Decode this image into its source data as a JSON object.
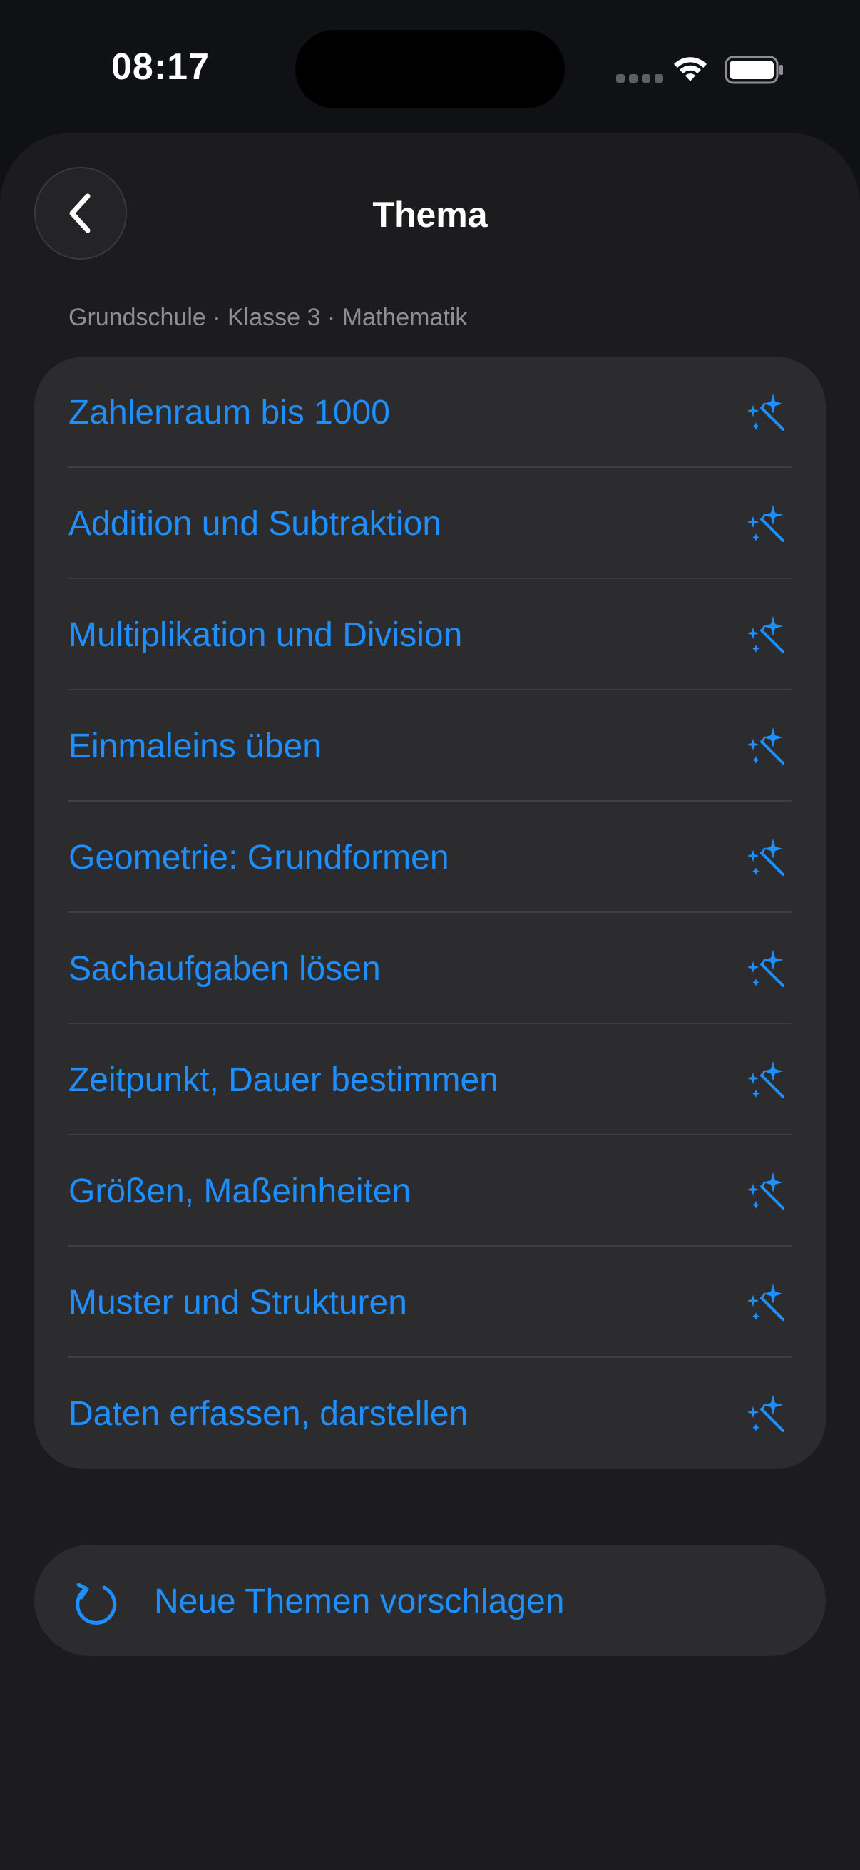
{
  "status_bar": {
    "time": "08:17"
  },
  "header": {
    "title": "Thema",
    "back_icon": "chevron-left-icon"
  },
  "breadcrumb": "Grundschule · Klasse 3 · Mathematik",
  "topics": [
    {
      "label": "Zahlenraum bis 1000",
      "icon": "magic-wand-icon"
    },
    {
      "label": "Addition und Subtraktion",
      "icon": "magic-wand-icon"
    },
    {
      "label": "Multiplikation und Division",
      "icon": "magic-wand-icon"
    },
    {
      "label": "Einmaleins üben",
      "icon": "magic-wand-icon"
    },
    {
      "label": "Geometrie: Grundformen",
      "icon": "magic-wand-icon"
    },
    {
      "label": "Sachaufgaben lösen",
      "icon": "magic-wand-icon"
    },
    {
      "label": "Zeitpunkt, Dauer bestimmen",
      "icon": "magic-wand-icon"
    },
    {
      "label": "Größen, Maßeinheiten",
      "icon": "magic-wand-icon"
    },
    {
      "label": "Muster und Strukturen",
      "icon": "magic-wand-icon"
    },
    {
      "label": "Daten erfassen, darstellen",
      "icon": "magic-wand-icon"
    }
  ],
  "suggest": {
    "label": "Neue Themen vorschlagen",
    "icon": "refresh-icon"
  },
  "colors": {
    "accent": "#1e8fff",
    "background": "#1c1c1e",
    "card": "#2c2c2e",
    "secondary_text": "#8e8e93"
  }
}
